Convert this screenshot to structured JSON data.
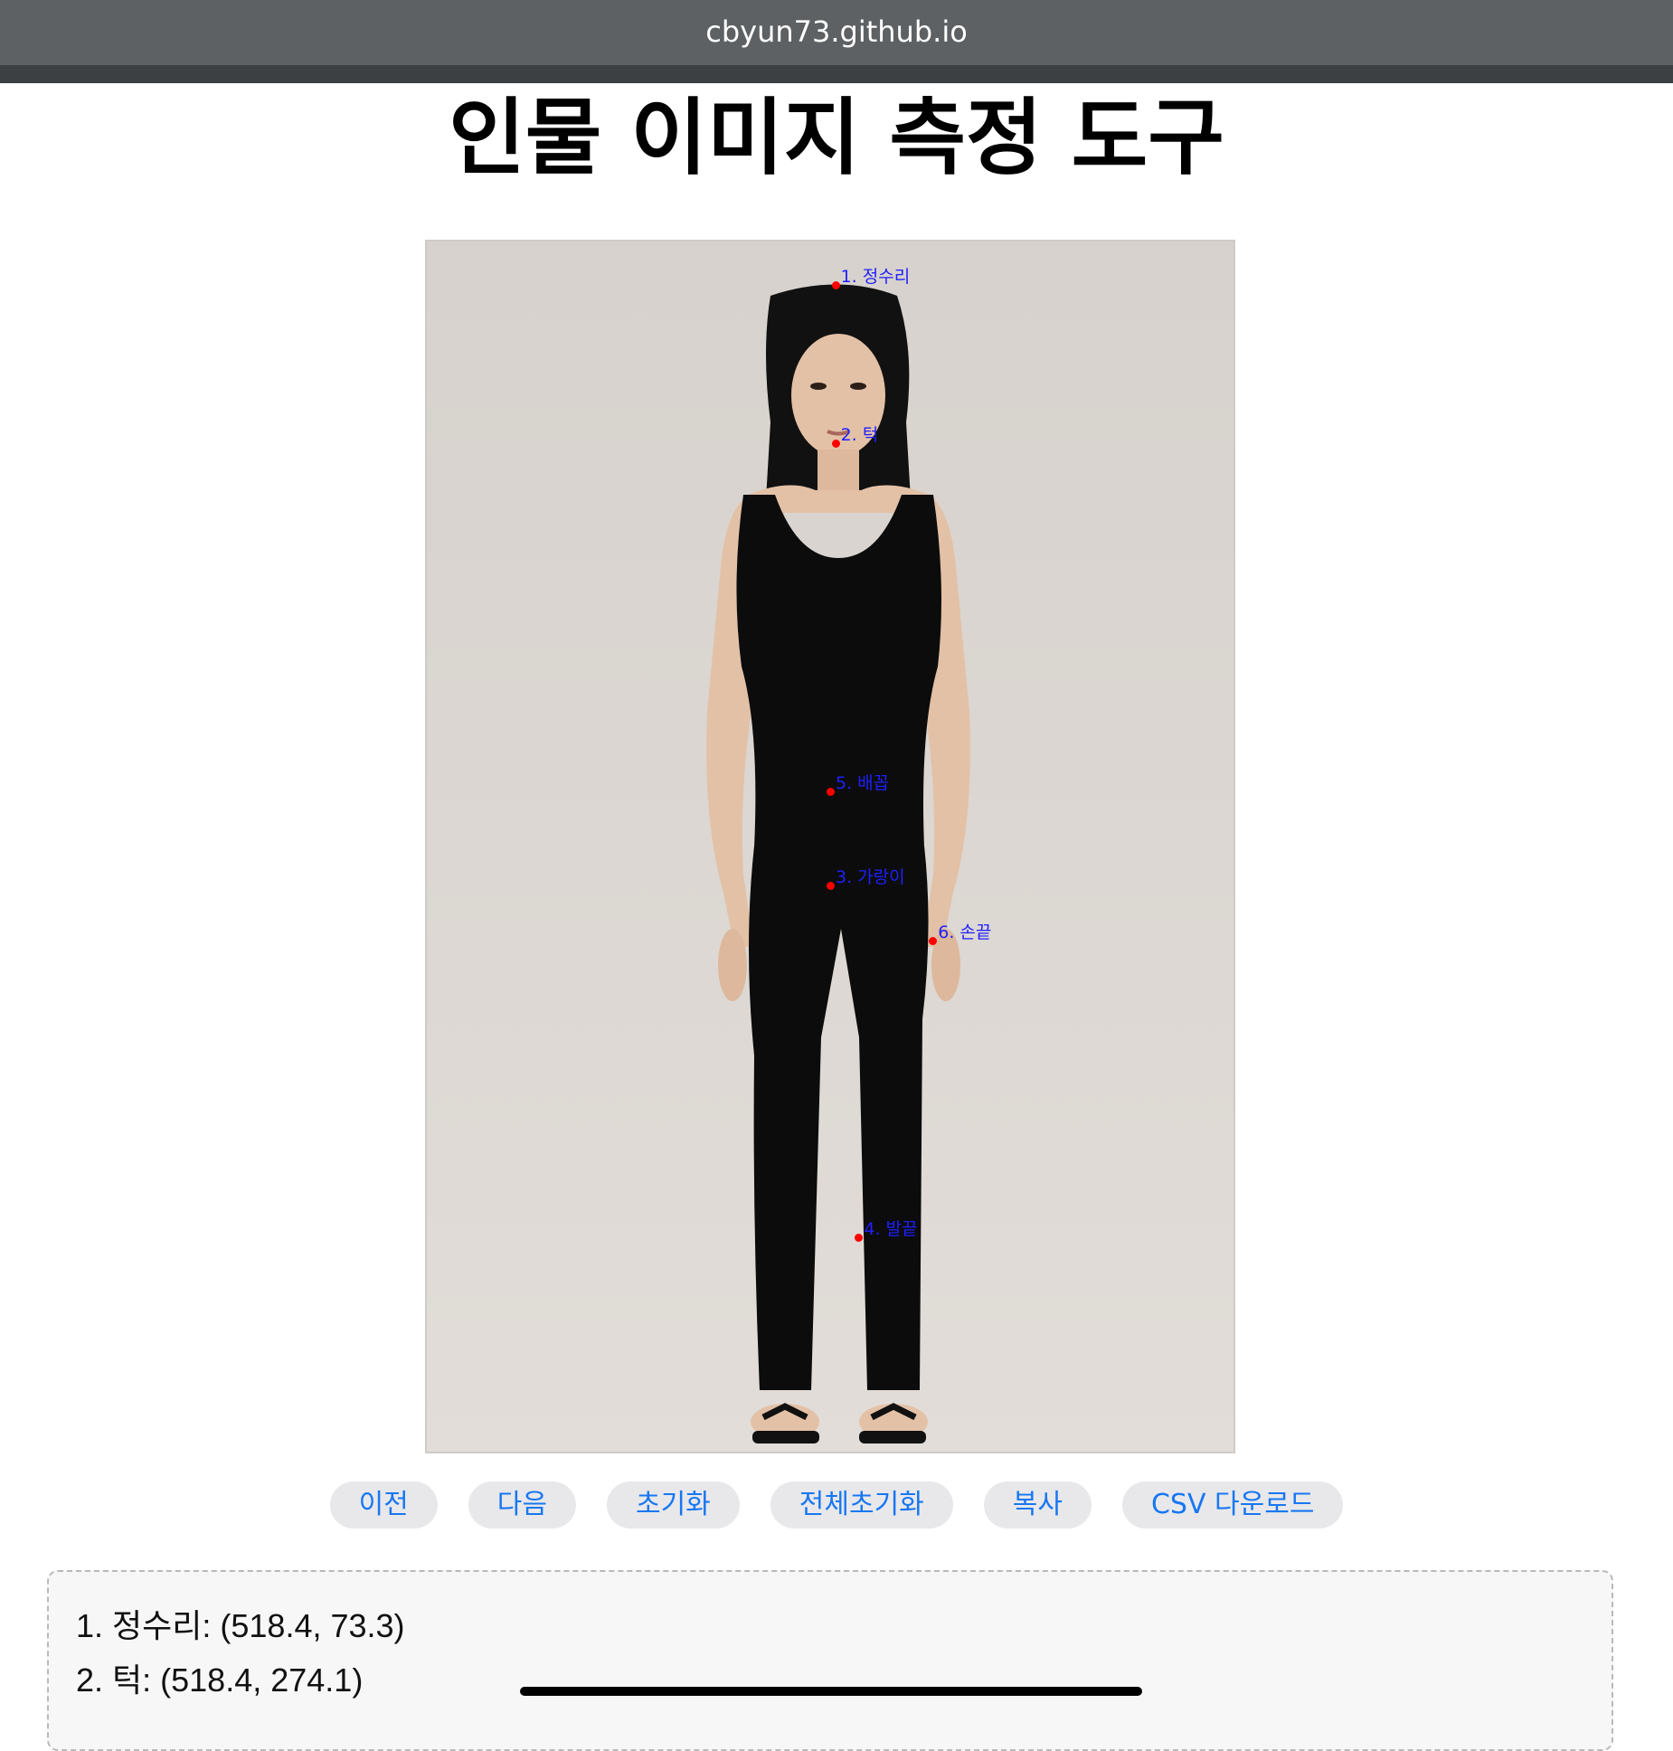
{
  "browser": {
    "url": "cbyun73.github.io"
  },
  "page": {
    "title": "인물 이미지 측정 도구"
  },
  "photo": {
    "alt": "person photo",
    "markers": [
      {
        "label": "1. 정수리",
        "x": 518.4,
        "y": 73.3
      },
      {
        "label": "2. 턱",
        "x": 518.4,
        "y": 274.1
      },
      {
        "label": "3. 가랑이",
        "x": 512.0,
        "y": 836.0
      },
      {
        "label": "4. 발끝",
        "x": 548.0,
        "y": 1282.0
      },
      {
        "label": "5. 배꼽",
        "x": 512.0,
        "y": 716.0
      },
      {
        "label": "6. 손끝",
        "x": 642.0,
        "y": 906.0
      }
    ]
  },
  "buttons": {
    "prev": "이전",
    "next": "다음",
    "reset": "초기화",
    "reset_all": "전체초기화",
    "copy": "복사",
    "csv": "CSV 다운로드"
  },
  "coords": {
    "lines": [
      "1. 정수리: (518.4, 73.3)",
      "2. 턱: (518.4, 274.1)"
    ]
  },
  "colors": {
    "marker": "#ff0000",
    "marker_label": "#1f1fff",
    "button_text": "#1877f2",
    "button_bg": "#e8e8ea"
  }
}
